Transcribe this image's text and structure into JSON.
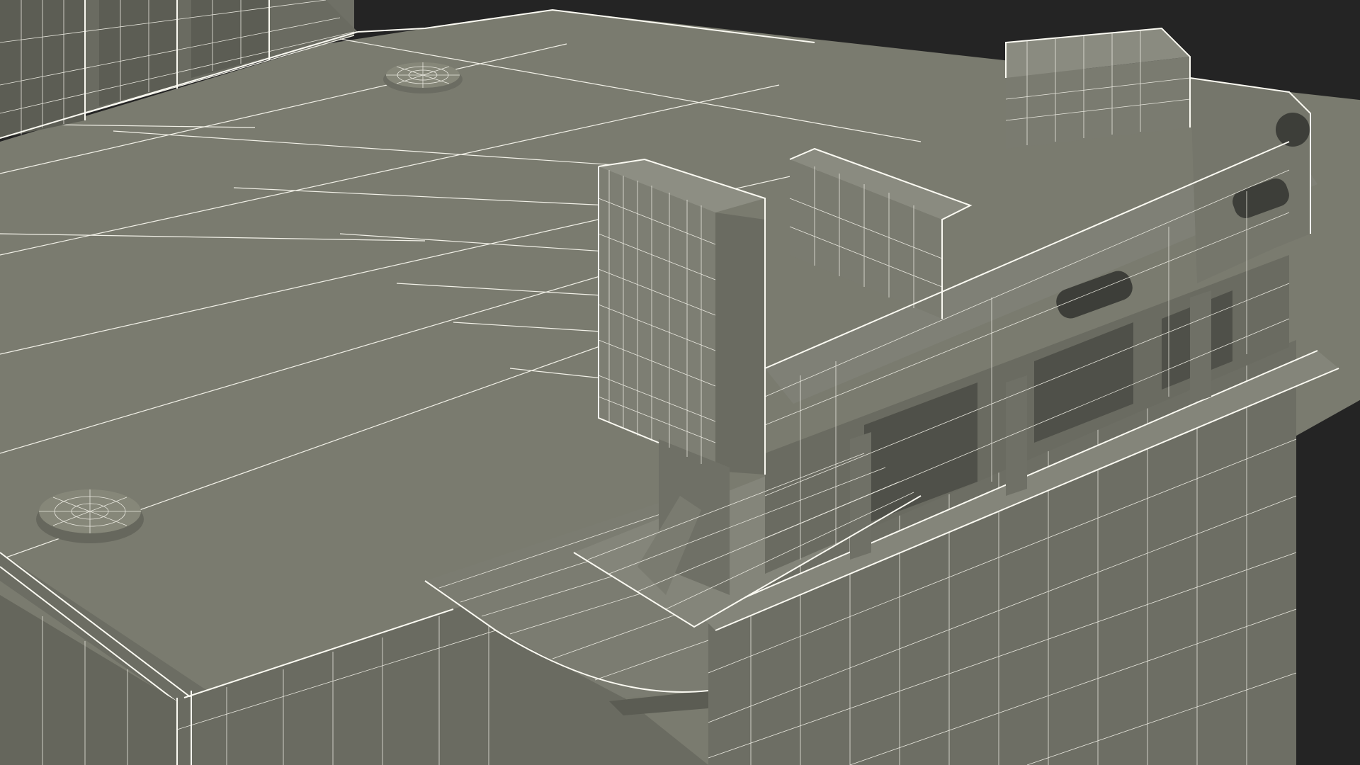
{
  "viewport": {
    "background_color": "#242424",
    "render_mode": "wireframe-on-shaded"
  },
  "model": {
    "surface_color": "#7a7b6f",
    "surface_dark_color": "#5f6056",
    "surface_light_color": "#8a8b80",
    "wire_color": "#f2f1e8"
  }
}
